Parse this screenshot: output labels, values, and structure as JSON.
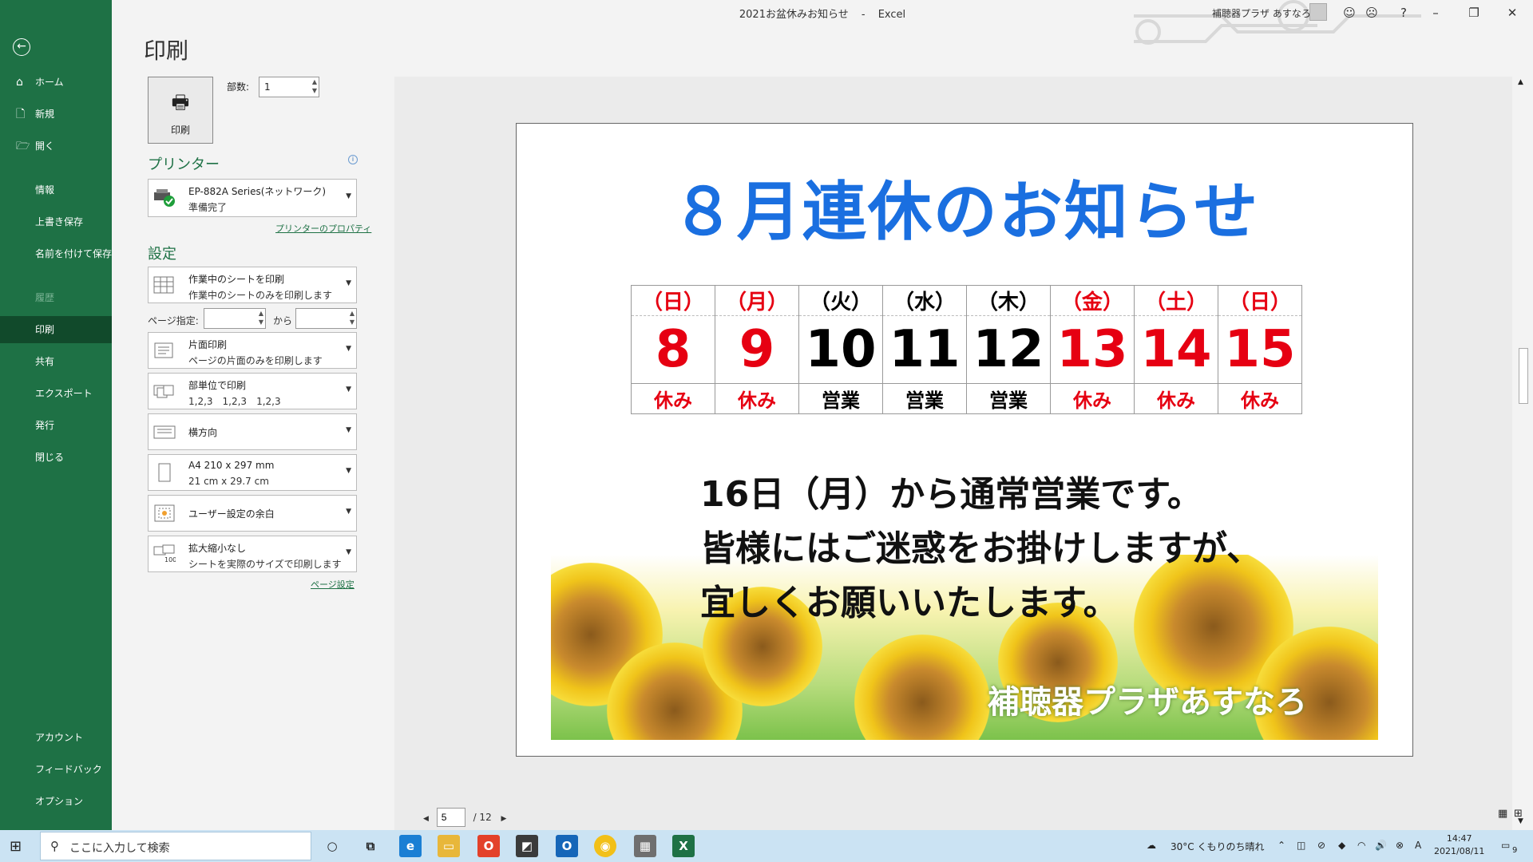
{
  "window": {
    "doc_title": "2021お盆休みお知らせ",
    "separator": "-",
    "app_name": "Excel",
    "user_name": "補聴器プラザ あすなろ",
    "help": "?"
  },
  "sidebar": {
    "items": [
      {
        "label": "ホーム",
        "icon": "home-icon"
      },
      {
        "label": "新規",
        "icon": "new-file-icon"
      },
      {
        "label": "開く",
        "icon": "open-folder-icon"
      },
      {
        "label": "情報"
      },
      {
        "label": "上書き保存"
      },
      {
        "label": "名前を付けて保存"
      },
      {
        "label": "履歴"
      },
      {
        "label": "印刷"
      },
      {
        "label": "共有"
      },
      {
        "label": "エクスポート"
      },
      {
        "label": "発行"
      },
      {
        "label": "閉じる"
      },
      {
        "label": "アカウント"
      },
      {
        "label": "フィードバック"
      },
      {
        "label": "オプション"
      }
    ]
  },
  "print_panel": {
    "heading": "印刷",
    "print_button": "印刷",
    "copies_label": "部数:",
    "copies_value": "1",
    "printer_heading": "プリンター",
    "printer_name": "EP-882A Series(ネットワーク)",
    "printer_status": "準備完了",
    "printer_props_link": "プリンターのプロパティ",
    "settings_heading": "設定",
    "settings": [
      {
        "l1": "作業中のシートを印刷",
        "l2": "作業中のシートのみを印刷します"
      },
      {
        "l1": "片面印刷",
        "l2": "ページの片面のみを印刷します"
      },
      {
        "l1": "部単位で印刷",
        "l2": "1,2,3　1,2,3　1,2,3"
      },
      {
        "l1": "横方向",
        "l2": ""
      },
      {
        "l1": "A4 210 x 297 mm",
        "l2": "21 cm x 29.7 cm"
      },
      {
        "l1": "ユーザー設定の余白",
        "l2": ""
      },
      {
        "l1": "拡大縮小なし",
        "l2": "シートを実際のサイズで印刷します"
      }
    ],
    "pages_label": "ページ指定:",
    "pages_to_label": "から",
    "page_setup_link": "ページ設定",
    "scaling_badge": "100"
  },
  "preview": {
    "headline": "８月連休のお知らせ",
    "calendar": {
      "weekdays": [
        "（日）",
        "（月）",
        "（火）",
        "（水）",
        "（木）",
        "（金）",
        "（土）",
        "（日）"
      ],
      "days": [
        "8",
        "9",
        "10",
        "11",
        "12",
        "13",
        "14",
        "15"
      ],
      "status": [
        "休み",
        "休み",
        "営業",
        "営業",
        "営業",
        "休み",
        "休み",
        "休み"
      ],
      "holiday_color": "#e60012",
      "normal_color": "#000000"
    },
    "lines": [
      "16日（月）から通常営業です。",
      "皆様にはご迷惑をお掛けしますが、",
      "宜しくお願いいたします。"
    ],
    "brand": "補聴器プラザあすなろ",
    "headline_color": "#1a6fe0"
  },
  "pager": {
    "current": "5",
    "total": "/ 12"
  },
  "taskbar": {
    "search_placeholder": "ここに入力して検索",
    "weather": "30°C くもりのち晴れ",
    "time": "14:47",
    "date": "2021/08/11",
    "notification_count": "9"
  },
  "theme": {
    "excel_green": "#1e7145",
    "active_nav": "#114a2b"
  }
}
